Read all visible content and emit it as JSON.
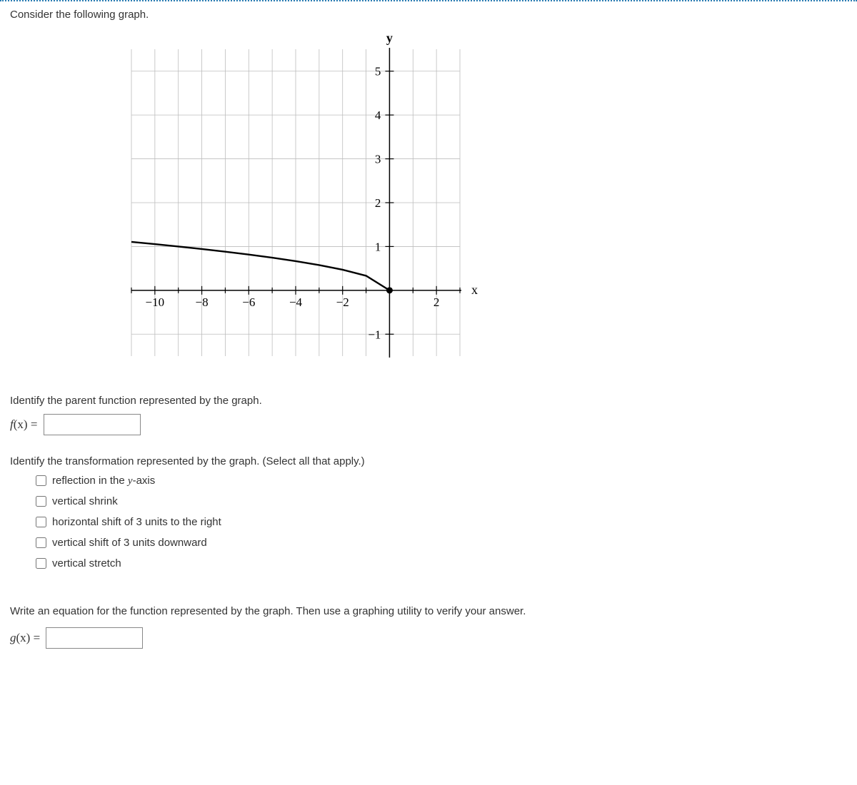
{
  "prompt": "Consider the following graph.",
  "q1": {
    "text": "Identify the parent function represented by the graph.",
    "label_prefix": "f",
    "label_arg": "(x)",
    "equals": " = "
  },
  "q2": {
    "text": "Identify the transformation represented by the graph. (Select all that apply.)",
    "options": [
      "reflection in the y-axis",
      "vertical shrink",
      "horizontal shift of 3 units to the right",
      "vertical shift of 3 units downward",
      "vertical stretch"
    ]
  },
  "q3": {
    "text": "Write an equation for the function represented by the graph. Then use a graphing utility to verify your answer.",
    "label_prefix": "g",
    "label_arg": "(x)",
    "equals": " = "
  },
  "chart_data": {
    "type": "line",
    "title": "",
    "xlabel": "x",
    "ylabel": "y",
    "xlim": [
      -11,
      3
    ],
    "ylim": [
      -1.5,
      5.5
    ],
    "x_ticks": [
      -10,
      -8,
      -6,
      -4,
      -2,
      2
    ],
    "y_ticks": [
      -1,
      1,
      2,
      3,
      4,
      5
    ],
    "grid": true,
    "series": [
      {
        "name": "curve",
        "x": [
          -11,
          -10,
          -9,
          -8,
          -7,
          -6,
          -5,
          -4,
          -3,
          -2,
          -1,
          0
        ],
        "y": [
          1.106,
          1.054,
          1.0,
          0.943,
          0.882,
          0.816,
          0.745,
          0.667,
          0.577,
          0.471,
          0.333,
          0.0
        ],
        "endpoint": {
          "x": 0,
          "y": 0,
          "closed": true
        }
      }
    ]
  }
}
